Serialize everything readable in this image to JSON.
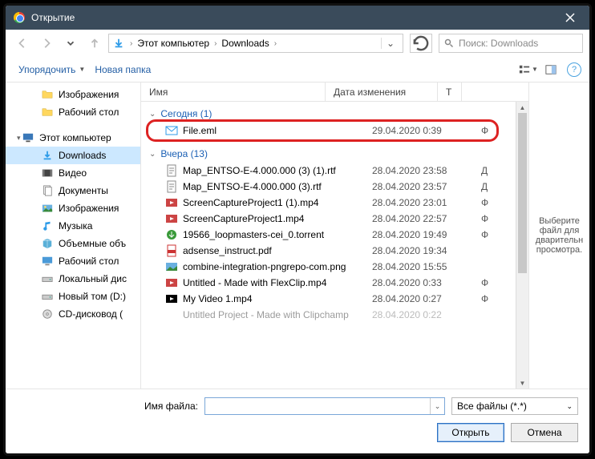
{
  "titlebar": {
    "title": "Открытие"
  },
  "nav": {
    "crumb_root": "Этот компьютер",
    "crumb_folder": "Downloads",
    "search_placeholder": "Поиск: Downloads"
  },
  "toolbar": {
    "organize": "Упорядочить",
    "newfolder": "Новая папка"
  },
  "sidebar": {
    "items": [
      {
        "label": "Изображения"
      },
      {
        "label": "Рабочий стол"
      },
      {
        "label": "Этот компьютер"
      },
      {
        "label": "Downloads"
      },
      {
        "label": "Видео"
      },
      {
        "label": "Документы"
      },
      {
        "label": "Изображения"
      },
      {
        "label": "Музыка"
      },
      {
        "label": "Объемные объ"
      },
      {
        "label": "Рабочий стол"
      },
      {
        "label": "Локальный дис"
      },
      {
        "label": "Новый том (D:)"
      },
      {
        "label": "CD-дисковод ("
      }
    ]
  },
  "columns": {
    "name": "Имя",
    "date": "Дата изменения",
    "type": "Т"
  },
  "groups": {
    "today": {
      "header": "Сегодня (1)"
    },
    "yesterday": {
      "header": "Вчера (13)"
    }
  },
  "files": {
    "today": [
      {
        "name": "File.eml",
        "date": "29.04.2020 0:39",
        "type": "Ф"
      }
    ],
    "yesterday": [
      {
        "name": "Map_ENTSO-E-4.000.000 (3) (1).rtf",
        "date": "28.04.2020 23:58",
        "type": "Д"
      },
      {
        "name": "Map_ENTSO-E-4.000.000 (3).rtf",
        "date": "28.04.2020 23:57",
        "type": "Д"
      },
      {
        "name": "ScreenCaptureProject1 (1).mp4",
        "date": "28.04.2020 23:01",
        "type": "Ф"
      },
      {
        "name": "ScreenCaptureProject1.mp4",
        "date": "28.04.2020 22:57",
        "type": "Ф"
      },
      {
        "name": "19566_loopmasters-cei_0.torrent",
        "date": "28.04.2020 19:49",
        "type": "Ф"
      },
      {
        "name": "adsense_instruct.pdf",
        "date": "28.04.2020 19:34",
        "type": ""
      },
      {
        "name": "combine-integration-pngrepo-com.png",
        "date": "28.04.2020 15:55",
        "type": ""
      },
      {
        "name": "Untitled - Made with FlexClip.mp4",
        "date": "28.04.2020 0:33",
        "type": "Ф"
      },
      {
        "name": "My Video 1.mp4",
        "date": "28.04.2020 0:27",
        "type": "Ф"
      },
      {
        "name": "Untitled Project - Made with Clipchamp",
        "date": "28.04.2020 0:22",
        "type": ""
      }
    ]
  },
  "preview": {
    "text": "Выберите файл для дварительн просмотра."
  },
  "bottom": {
    "filename_label": "Имя файла:",
    "filter_label": "Все файлы (*.*)",
    "open": "Открыть",
    "cancel": "Отмена"
  }
}
